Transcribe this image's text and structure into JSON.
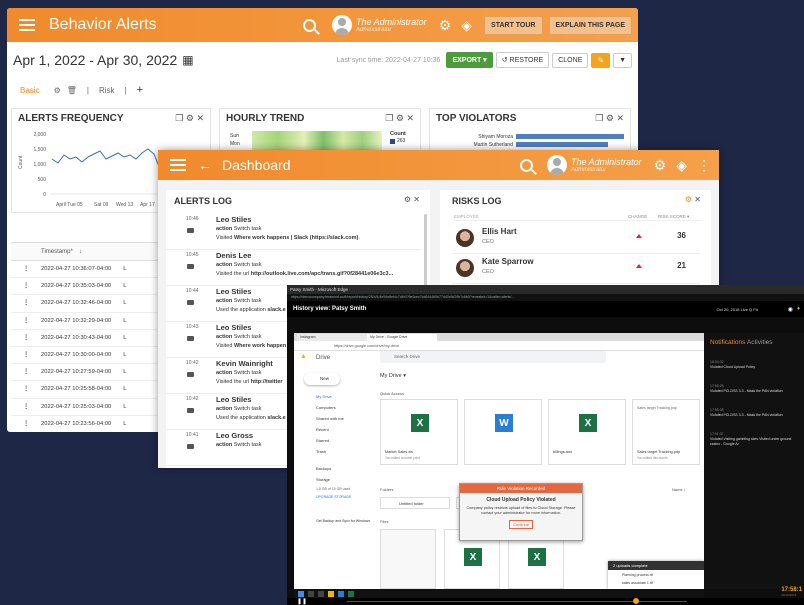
{
  "w1": {
    "title": "Behavior Alerts",
    "user": "The Administrator",
    "role": "Administrator",
    "start_tour": "START TOUR",
    "explain": "EXPLAIN THIS PAGE",
    "date_range": "Apr 1, 2022 - Apr 30, 2022",
    "sync": "Last sync time: 2022-04-27 10:36",
    "export": "EXPORT",
    "restore": "RESTORE",
    "clone": "CLONE",
    "tab_basic": "Basic",
    "tab_risk": "Risk",
    "alerts_freq": "ALERTS FREQUENCY",
    "hourly": "HOURLY TREND",
    "top_violators": "TOP VIOLATORS",
    "freq_y": [
      "2,000",
      "1,500",
      "1,000",
      "500",
      "0"
    ],
    "freq_ylabel": "Count",
    "freq_x": [
      "April Tue 05",
      "Sat 09",
      "Wed 13",
      "Apr 17"
    ],
    "hourly_rows": [
      "Sun",
      "Mon"
    ],
    "hourly_count": "Count",
    "hourly_legend": "263",
    "violators": [
      "Shiyam Moroza",
      "Martin Sutherland"
    ],
    "col_timestamp": "Timestamp*",
    "timestamps": [
      "2022-04-27 10:36:07-04:00",
      "2022-04-27 10:35:03-04:00",
      "2022-04-27 10:32:46-04:00",
      "2022-04-27 10:32:29-04:00",
      "2022-04-27 10:30:43-04:00",
      "2022-04-27 10:30:00-04:00",
      "2022-04-27 10:27:59-04:00",
      "2022-04-27 10:25:58-04:00",
      "2022-04-27 10:25:03-04:00",
      "2022-04-27 10:23:56-04:00"
    ],
    "row_flag": "L"
  },
  "w2": {
    "title": "Dashboard",
    "user": "The Administrator",
    "role": "Administrator",
    "alerts_log": "ALERTS LOG",
    "risks_log": "RISKS LOG",
    "col_employee": "EMPLOYEE",
    "col_change": "CHANGE",
    "col_risk": "RISK SCORE",
    "alerts": [
      {
        "time": "10:46",
        "name": "Leo Stiles",
        "l1b": "action",
        "l1": " Switch task",
        "l2": "Visited ",
        "l2b": "Where work happens | Slack (https://slack.com)",
        "l2e": "."
      },
      {
        "time": "10:45",
        "name": "Denis Lee",
        "l1b": "action",
        "l1": " Switch task",
        "l2": "Visited the url ",
        "l2b": "http://outlook.live.com/apc/trans.gif?0f28441e06e3c3...",
        "l2e": ""
      },
      {
        "time": "10:44",
        "name": "Leo Stiles",
        "l1b": "action",
        "l1": " Switch task",
        "l2": "Used the application ",
        "l2b": "slack.e",
        "l2e": ""
      },
      {
        "time": "10:43",
        "name": "Leo Stiles",
        "l1b": "action",
        "l1": " Switch task",
        "l2": "Visited ",
        "l2b": "Where work happen",
        "l2e": ""
      },
      {
        "time": "10:42",
        "name": "Kevin Wainright",
        "l1b": "action",
        "l1": " Switch task",
        "l2": "Visited the url ",
        "l2b": "http://twitter",
        "l2e": ""
      },
      {
        "time": "10:42",
        "name": "Leo Stiles",
        "l1b": "action",
        "l1": " Switch task",
        "l2": "Used the application ",
        "l2b": "slack.e",
        "l2e": ""
      },
      {
        "time": "10:41",
        "name": "Leo Gross",
        "l1b": "action",
        "l1": " Switch task",
        "l2": "",
        "l2b": "",
        "l2e": ""
      }
    ],
    "risks": [
      {
        "name": "Ellis Hart",
        "role": "CEO",
        "score": "36"
      },
      {
        "name": "Kate Sparrow",
        "role": "CEO",
        "score": "21"
      }
    ]
  },
  "w3": {
    "wintitle": "Patsy Smith - Microsoft Edge",
    "url": "https://democompany.teramind.co/#/report/history/25/4/5/4e94e8ef4c7d4b7/9e0cec7cd644460b77d40c5d29b7c6b0?revealed=1&caller=alerts/...",
    "header": "History view: Patsy Smith",
    "header_right": "Oct 20, 2018  Live  Q Fit",
    "tab1": "Instagram",
    "tab2": "My Drive - Google Drive",
    "address": "https://drive.google.com/drive/my-drive",
    "drive": "Drive",
    "search": "Search Drive",
    "new": "New",
    "side": [
      "My Drive",
      "Computers",
      "Shared with me",
      "Recent",
      "Starred",
      "Trash",
      "Backups",
      "Storage"
    ],
    "storage_used": "1.5 GB of 15 GB used",
    "upgrade": "UPGRADE STORAGE",
    "backup_sync": "Get Backup and Sync for Windows",
    "mydrive": "My Drive",
    "quick": "Quick Access",
    "folders": "Folders",
    "name_col": "Name",
    "folder1": "Untitled folder",
    "folder2": "Files",
    "files": "Files",
    "tile1": "Market Sales.xls",
    "tile1s": "You edited at some point",
    "tile2": "Sales target Tracking.pdp",
    "tile2s": "You edited this month",
    "tile3": "Sales target Tracking.pdp",
    "tile_mid": "billings.xlsx",
    "modal_head": "Rule Violation Recorded",
    "modal_title": "Cloud Upload Policy Violated",
    "modal_body": "Company policy restricts upload of files to Cloud Storage. Please contact your administrator for more information.",
    "modal_btn": "Continue",
    "uploads": "2 uploads complete",
    "up1": "Planning process.rtf",
    "up2": "sales associate 1.rtf",
    "notifications": "Notifications",
    "activities": "Activities",
    "notes": [
      {
        "t": "18:04:32",
        "m": "Violated Cloud Upload Policy"
      },
      {
        "t": "17:56:26",
        "m": "Violated PCI-DSS 3.3 - Mask the PAN violation"
      },
      {
        "t": "17:55:38",
        "m": "Violated PCI-DSS 3.3 - Mask the PAN violation"
      },
      {
        "t": "17:51:37",
        "m": "Violated Visiting gambling sites Visited under ground casino - Google Ar"
      }
    ],
    "clock": "17:58:1",
    "clock_date": "20/10/2018"
  },
  "colors": {
    "orange": "#f08a2c",
    "bg": "#1f2747",
    "green": "#4e9a3e"
  }
}
